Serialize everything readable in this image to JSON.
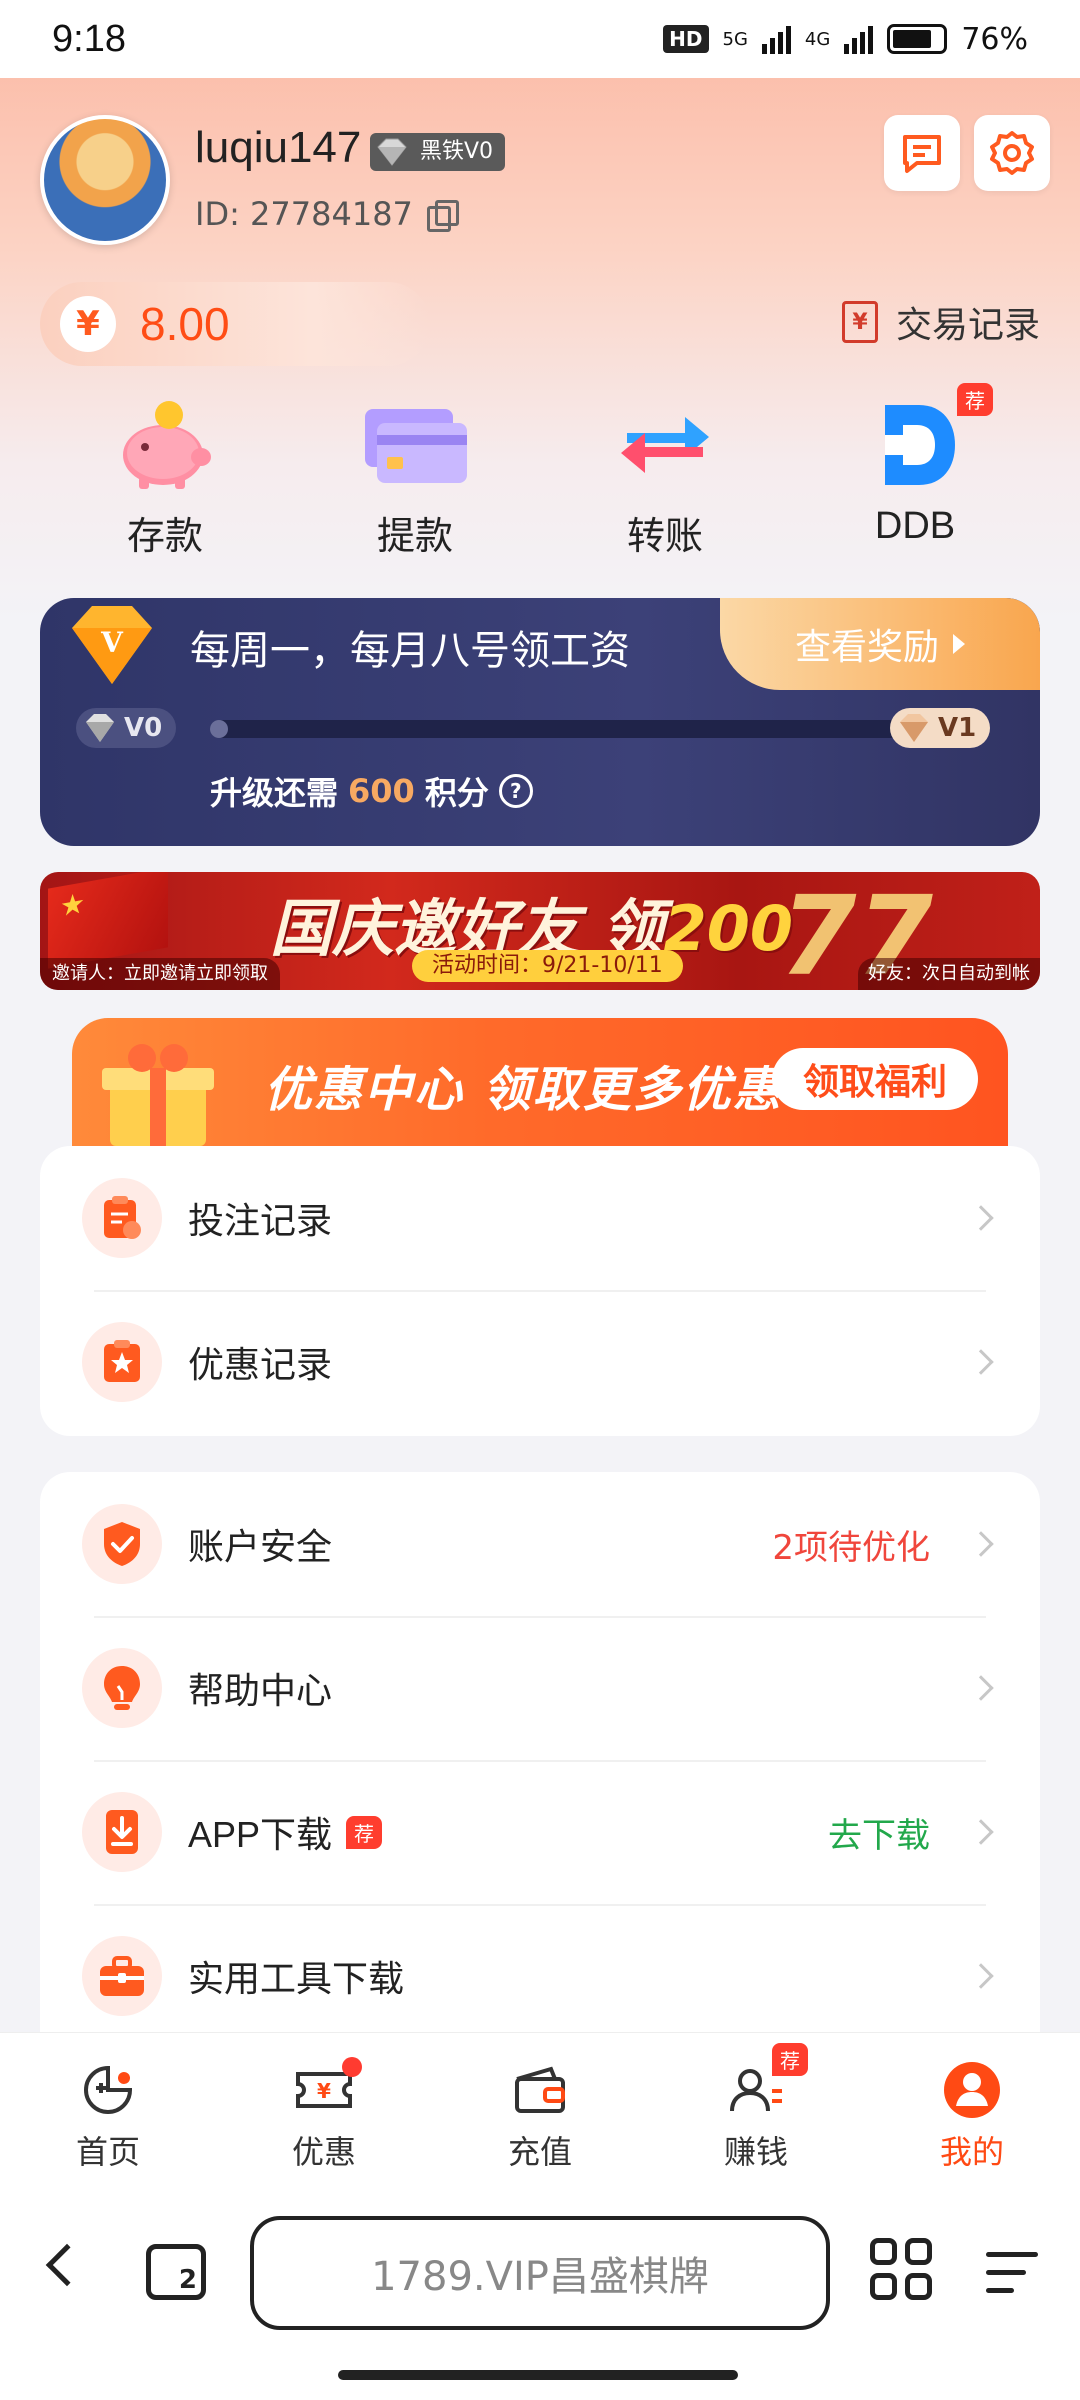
{
  "status_bar": {
    "time": "9:18",
    "network_a": "5G",
    "network_b": "4G",
    "battery": "76%"
  },
  "profile": {
    "username": "luqiu147",
    "vip_badge": "黑铁V0",
    "id_label": "ID: 27784187"
  },
  "wallet": {
    "currency_symbol": "¥",
    "balance": "8.00",
    "trade_records": "交易记录"
  },
  "actions": [
    {
      "label": "存款",
      "icon": "piggy-bank-icon"
    },
    {
      "label": "提款",
      "icon": "credit-card-icon"
    },
    {
      "label": "转账",
      "icon": "transfer-icon"
    },
    {
      "label": "DDB",
      "icon": "ddb-icon",
      "tag": "荐"
    }
  ],
  "vip_card": {
    "title": "每周一，每月八号领工资",
    "reward_button": "查看奖励",
    "current_level": "V0",
    "next_level": "V1",
    "progress_prefix": "升级还需",
    "points_needed": "600",
    "progress_suffix": "积分",
    "progress_fraction": 0.0
  },
  "banner": {
    "title_text": "国庆邀好友 领",
    "title_number": "200",
    "time_label": "活动时间：9/21-10/11",
    "big_number": "77",
    "left_note": "邀请人：立即邀请立即领取",
    "right_note": "好友：次日自动到帐"
  },
  "promo": {
    "title": "优惠中心 领取更多优惠",
    "button": "领取福利"
  },
  "records_card": [
    {
      "label": "投注记录",
      "icon": "bet-record-icon"
    },
    {
      "label": "优惠记录",
      "icon": "promo-record-icon"
    }
  ],
  "settings_card": [
    {
      "label": "账户安全",
      "icon": "shield-icon",
      "value": "2项待优化",
      "value_color": "#f0463c"
    },
    {
      "label": "帮助中心",
      "icon": "lightbulb-icon",
      "value": ""
    },
    {
      "label": "APP下载",
      "icon": "download-icon",
      "tag": "荐",
      "value": "去下载",
      "value_color": "#22a84b"
    },
    {
      "label": "实用工具下载",
      "icon": "toolbox-icon",
      "value": ""
    }
  ],
  "tabbar": [
    {
      "label": "首页",
      "icon": "home-game-icon"
    },
    {
      "label": "优惠",
      "icon": "coupon-icon",
      "dot": true
    },
    {
      "label": "充值",
      "icon": "wallet-icon"
    },
    {
      "label": "赚钱",
      "icon": "referral-icon",
      "tag": "荐"
    },
    {
      "label": "我的",
      "icon": "profile-icon",
      "active": true
    }
  ],
  "browser": {
    "url": "1789.VIP昌盛棋牌",
    "tab_count": "2"
  },
  "colors": {
    "accent": "#ff4a14",
    "vip_bg": "#343968",
    "reward_gold": "#f9a64e"
  }
}
